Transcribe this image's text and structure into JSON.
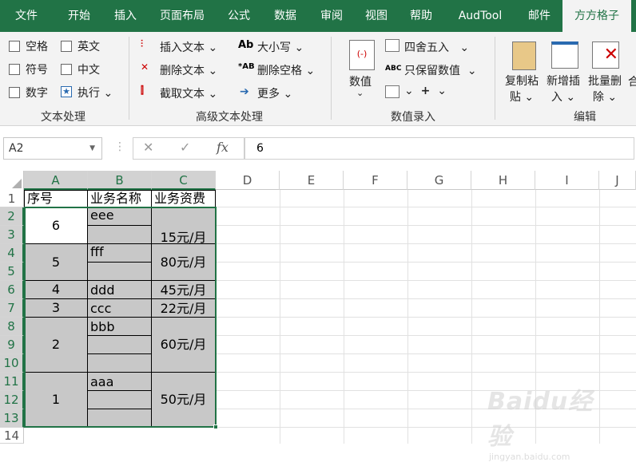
{
  "tabs": [
    "文件",
    "开始",
    "插入",
    "页面布局",
    "公式",
    "数据",
    "审阅",
    "视图",
    "帮助",
    "AudTool",
    "邮件",
    "方方格子"
  ],
  "ribbon": {
    "g1": {
      "label": "文本处理",
      "items": [
        "空格",
        "英文",
        "符号",
        "中文",
        "数字",
        "执行"
      ]
    },
    "g2": {
      "label": "高级文本处理",
      "items": [
        "插入文本",
        "删除文本",
        "截取文本",
        "大小写",
        "删除空格",
        "更多"
      ]
    },
    "g3": {
      "label": "数值录入",
      "big": "数值",
      "items": [
        "四舍五入",
        "只保留数值"
      ]
    },
    "g4": {
      "label": "编辑",
      "items": [
        "复制粘",
        "贴",
        "新增插",
        "入",
        "批量删",
        "除",
        "合"
      ]
    }
  },
  "formula_bar": {
    "name_box": "A2",
    "fx": "fx",
    "value": "6"
  },
  "columns": [
    "A",
    "B",
    "C",
    "D",
    "E",
    "F",
    "G",
    "H",
    "I",
    "J"
  ],
  "rows": [
    "1",
    "2",
    "3",
    "4",
    "5",
    "6",
    "7",
    "8",
    "9",
    "10",
    "11",
    "12",
    "13",
    "14"
  ],
  "cells": {
    "a1": "序号",
    "b1": "业务名称",
    "c1": "业务资费",
    "a2": "6",
    "b2": "eee",
    "c2": "15元/月",
    "a4": "5",
    "b4": "fff",
    "c4": "80元/月",
    "a6": "4",
    "b6": "ddd",
    "c6": "45元/月",
    "a7": "3",
    "b7": "ccc",
    "c7": "22元/月",
    "a8": "2",
    "b8": "bbb",
    "c8": "60元/月",
    "a11": "1",
    "b11": "aaa",
    "c11": "50元/月"
  },
  "watermark": "Baidu经验",
  "watermark_sub": "jingyan.baidu.com"
}
